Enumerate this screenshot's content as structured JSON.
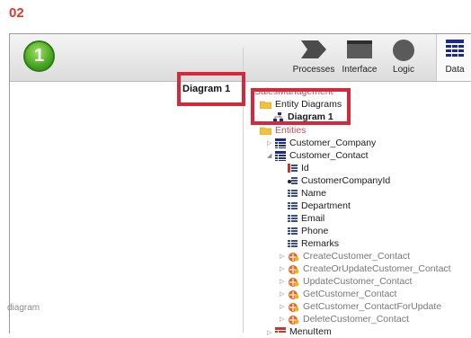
{
  "step_label": "02",
  "step_number": "1",
  "toolbar": {
    "buttons": [
      {
        "label": "Processes",
        "icon": "chevron-arrow-icon"
      },
      {
        "label": "Interface",
        "icon": "window-icon"
      },
      {
        "label": "Logic",
        "icon": "circle-icon"
      },
      {
        "label": "Data",
        "icon": "grid-icon"
      }
    ]
  },
  "canvas": {
    "tab_label": "Diagram 1",
    "hint_text": "diagram"
  },
  "tree": {
    "root": "SalesManagement",
    "entity_diagrams": "Entity Diagrams",
    "diagram": "Diagram 1",
    "entities": "Entities",
    "entity_company": "Customer_Company",
    "entity_contact": "Customer_Contact",
    "attributes": [
      "Id",
      "CustomerCompanyId",
      "Name",
      "Department",
      "Email",
      "Phone",
      "Remarks"
    ],
    "actions": [
      "CreateCustomer_Contact",
      "CreateOrUpdateCustomer_Contact",
      "UpdateCustomer_Contact",
      "GetCustomer_Contact",
      "GetCustomer_ContactForUpdate",
      "DeleteCustomer_Contact"
    ],
    "next_item": "MenuItem"
  },
  "colors": {
    "highlight": "#d6283c",
    "step": "#e0382a",
    "green": "#3c9a1a",
    "entity_blue": "#1c2a8c"
  }
}
